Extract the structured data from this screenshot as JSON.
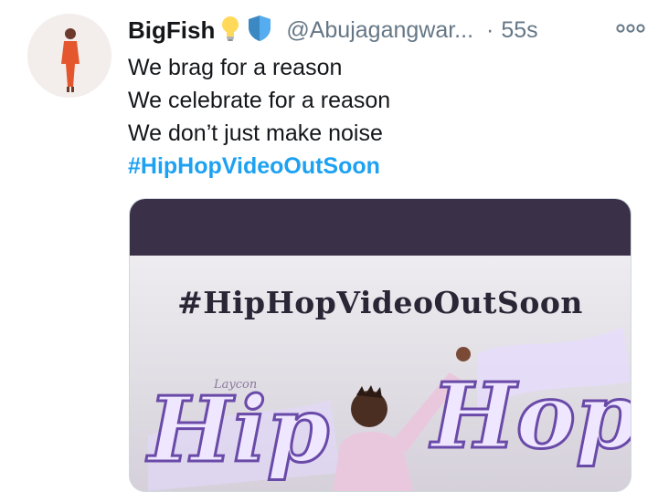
{
  "tweet": {
    "display_name": "BigFish",
    "badge_icons": [
      "lightbulb-icon",
      "shield-icon"
    ],
    "handle": "@Abujagangwar...",
    "separator": "·",
    "time": "55s",
    "lines": [
      "We brag for a reason",
      "We celebrate for a reason",
      "We don’t just make noise"
    ],
    "hashtag": "#HipHopVideoOutSoon",
    "more_icon": "more-options-icon"
  },
  "media": {
    "headline": "#HipHopVideoOutSoon",
    "small_script": "Laycon",
    "word_left": "Hip",
    "word_right": "Hop"
  },
  "colors": {
    "hashtag_blue": "#1da1f2",
    "handle_gray": "#657786",
    "media_top_bar": "#3a3148"
  }
}
